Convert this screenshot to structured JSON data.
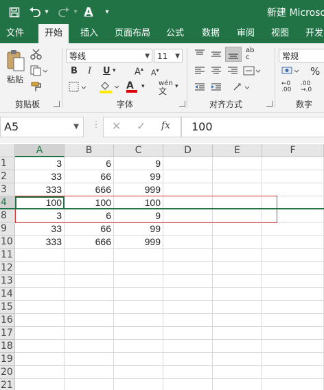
{
  "window": {
    "title": "新建 Microsoft"
  },
  "quick_access": {
    "undo_arrow": "▾",
    "font_color_letter": "A",
    "more": "▾"
  },
  "tabs": [
    {
      "label": "文件"
    },
    {
      "label": "开始"
    },
    {
      "label": "插入"
    },
    {
      "label": "页面布局"
    },
    {
      "label": "公式"
    },
    {
      "label": "数据"
    },
    {
      "label": "审阅"
    },
    {
      "label": "视图"
    },
    {
      "label": "开发"
    }
  ],
  "ribbon": {
    "clipboard": {
      "label": "剪贴板",
      "paste_label": "粘贴"
    },
    "font": {
      "label": "字体",
      "font_name": "等线",
      "font_size": "11",
      "bold": "B",
      "italic": "I",
      "underline": "U",
      "grow": "A",
      "shrink": "A",
      "wen": "wén",
      "font_color": "A"
    },
    "alignment": {
      "label": "对齐方式"
    },
    "number": {
      "label": "数字",
      "format": "常规",
      "percent": "%"
    }
  },
  "formula_bar": {
    "name_box": "A5",
    "fx": "fx",
    "value": "100"
  },
  "sheet": {
    "columns": [
      "A",
      "B",
      "C",
      "D",
      "E",
      "F"
    ],
    "rows": [
      {
        "num": "1",
        "cells": [
          "3",
          "6",
          "9"
        ]
      },
      {
        "num": "2",
        "cells": [
          "33",
          "66",
          "99"
        ]
      },
      {
        "num": "3",
        "cells": [
          "333",
          "666",
          "999"
        ]
      },
      {
        "num": "4",
        "cells": [
          "100",
          "100",
          "100"
        ]
      },
      {
        "num": "8",
        "cells": [
          "3",
          "6",
          "9"
        ]
      },
      {
        "num": "9",
        "cells": [
          "33",
          "66",
          "99"
        ]
      },
      {
        "num": "10",
        "cells": [
          "333",
          "666",
          "999"
        ]
      },
      {
        "num": "11",
        "cells": [
          "",
          "",
          ""
        ]
      },
      {
        "num": "12",
        "cells": [
          "",
          "",
          ""
        ]
      },
      {
        "num": "13",
        "cells": [
          "",
          "",
          ""
        ]
      },
      {
        "num": "14",
        "cells": [
          "",
          "",
          ""
        ]
      },
      {
        "num": "15",
        "cells": [
          "",
          "",
          ""
        ]
      },
      {
        "num": "16",
        "cells": [
          "",
          "",
          ""
        ]
      },
      {
        "num": "17",
        "cells": [
          "",
          "",
          ""
        ]
      },
      {
        "num": "18",
        "cells": [
          "",
          "",
          ""
        ]
      },
      {
        "num": "19",
        "cells": [
          "",
          "",
          ""
        ]
      },
      {
        "num": "20",
        "cells": [
          "",
          "",
          ""
        ]
      },
      {
        "num": "21",
        "cells": [
          "",
          "",
          ""
        ]
      }
    ]
  },
  "colors": {
    "brand_green": "#217346",
    "highlight_yellow": "#ffeb00",
    "font_red": "#e00000",
    "selection_red": "#dd3333"
  }
}
